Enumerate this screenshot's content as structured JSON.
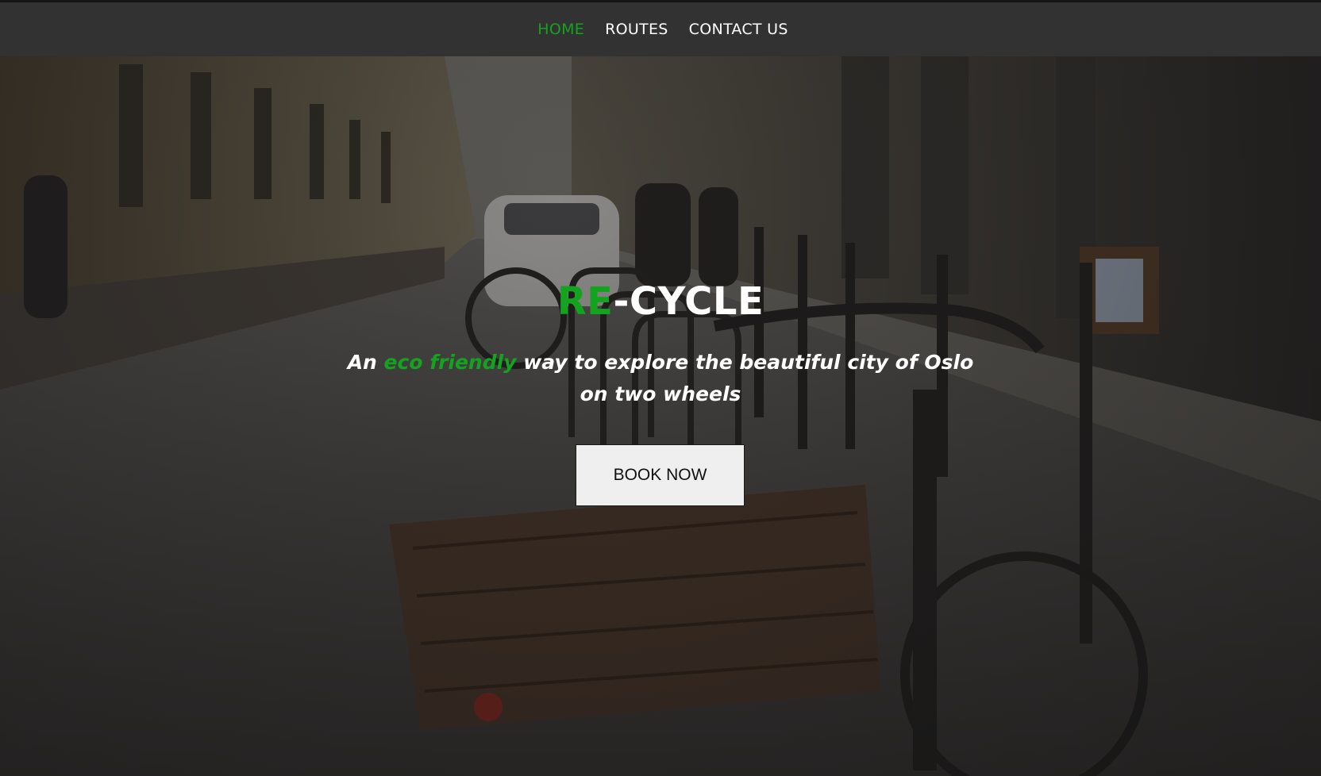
{
  "nav": {
    "items": [
      {
        "label": "HOME",
        "active": true
      },
      {
        "label": "ROUTES",
        "active": false
      },
      {
        "label": "CONTACT US",
        "active": false
      }
    ]
  },
  "hero": {
    "title_accent": "RE",
    "title_rest": "-CYCLE",
    "tagline_start": "An ",
    "tagline_accent": "eco friendly",
    "tagline_end": " way to explore the beautiful city of Oslo on two wheels",
    "cta_label": "BOOK NOW",
    "background_image": "street-with-parked-bicycles"
  },
  "colors": {
    "accent": "#14a31f",
    "nav_bg": "#323232",
    "text": "#ffffff",
    "button_bg": "#efefef"
  }
}
